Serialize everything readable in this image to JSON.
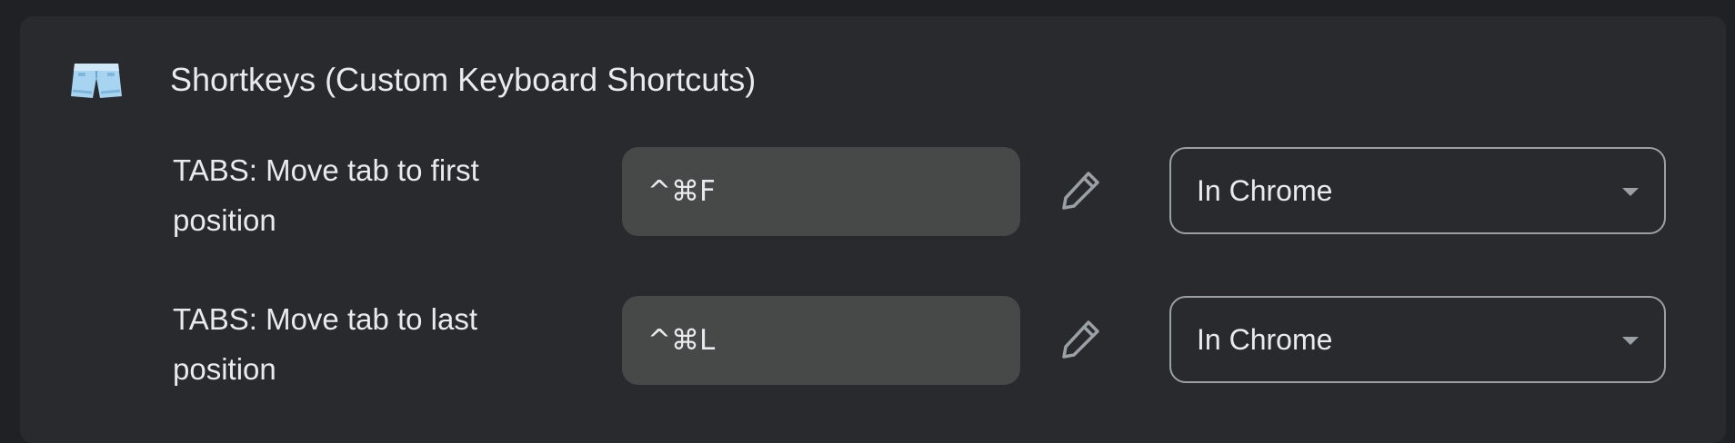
{
  "extension": {
    "title": "Shortkeys (Custom Keyboard Shortcuts)",
    "icon": "shorts-icon"
  },
  "shortcuts": [
    {
      "command": "TABS: Move tab to first position",
      "keys": "^⌘F",
      "scope": "In Chrome"
    },
    {
      "command": "TABS: Move tab to last position",
      "keys": "^⌘L",
      "scope": "In Chrome"
    }
  ],
  "colors": {
    "background": "#202124",
    "card": "#292a2d",
    "input": "#474948",
    "text": "#e8eaed",
    "muted": "#9aa0a6"
  }
}
